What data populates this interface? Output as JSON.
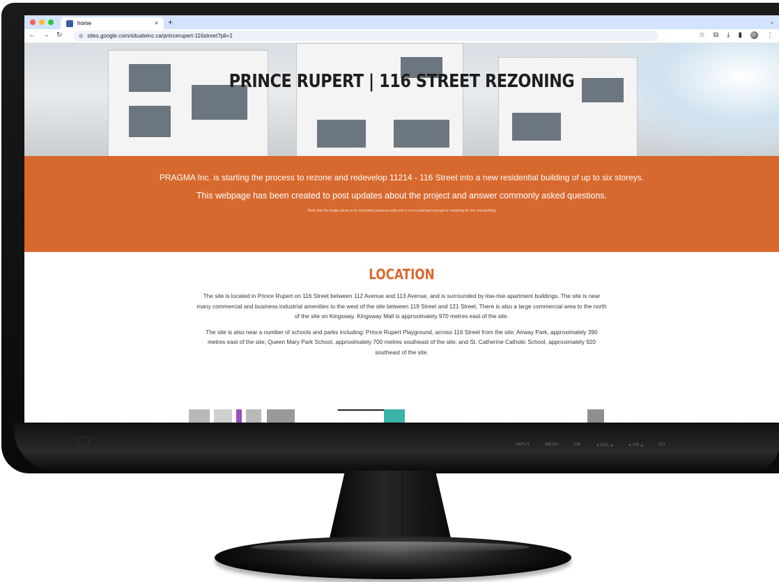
{
  "browser": {
    "tab_title": "home",
    "tab_close": "×",
    "new_tab": "+",
    "url": "sites.google.com/situateinc.ca/princerupert-116street?pli=1",
    "dot_colors": [
      "#ff5f57",
      "#febc2e",
      "#28c840"
    ]
  },
  "hero": {
    "title": "PRINCE RUPERT | 116 STREET REZONING"
  },
  "banner": {
    "paragraph1": "PRAGMA Inc. is starting the process to rezone and redevelop 11214 - 116 Street into a new residential building of up to six storeys.",
    "paragraph2": "This webpage has been created to post updates about the project and answer commonly asked questions.",
    "note": "*Note that the image above is for illustrative purposes only and is not a proposed concept or rendering for the new building.",
    "color": "#d8692e"
  },
  "location": {
    "title": "LOCATION",
    "paragraph1": "The site is located in Prince Rupert on 116 Street between 112 Avenue and 113 Avenue, and is surrounded by low-rise apartment buildings. The site is near many commercial and business industrial amenities to the west of the site between 119 Street and 121 Street. There is also a large commercial area to the north of the site on Kingsway. Kingsway Mall is approximately 970 metres east of the site.",
    "paragraph2": "The site is also near a number of schools and parks including: Prince Rupert Playground, across 116 Street from the site; Airway Park, approximately 390 metres east of the site; Queen Mary Park School, approximately 700 metres southeast of the site; and St. Catherine Catholic School, approximately 920 southeast of the site."
  },
  "monitor": {
    "controls": [
      "INPUT",
      "MENU",
      "OK",
      "◂  VOL  ▸",
      "▾  PR  ▴",
      "⏻/I"
    ]
  }
}
